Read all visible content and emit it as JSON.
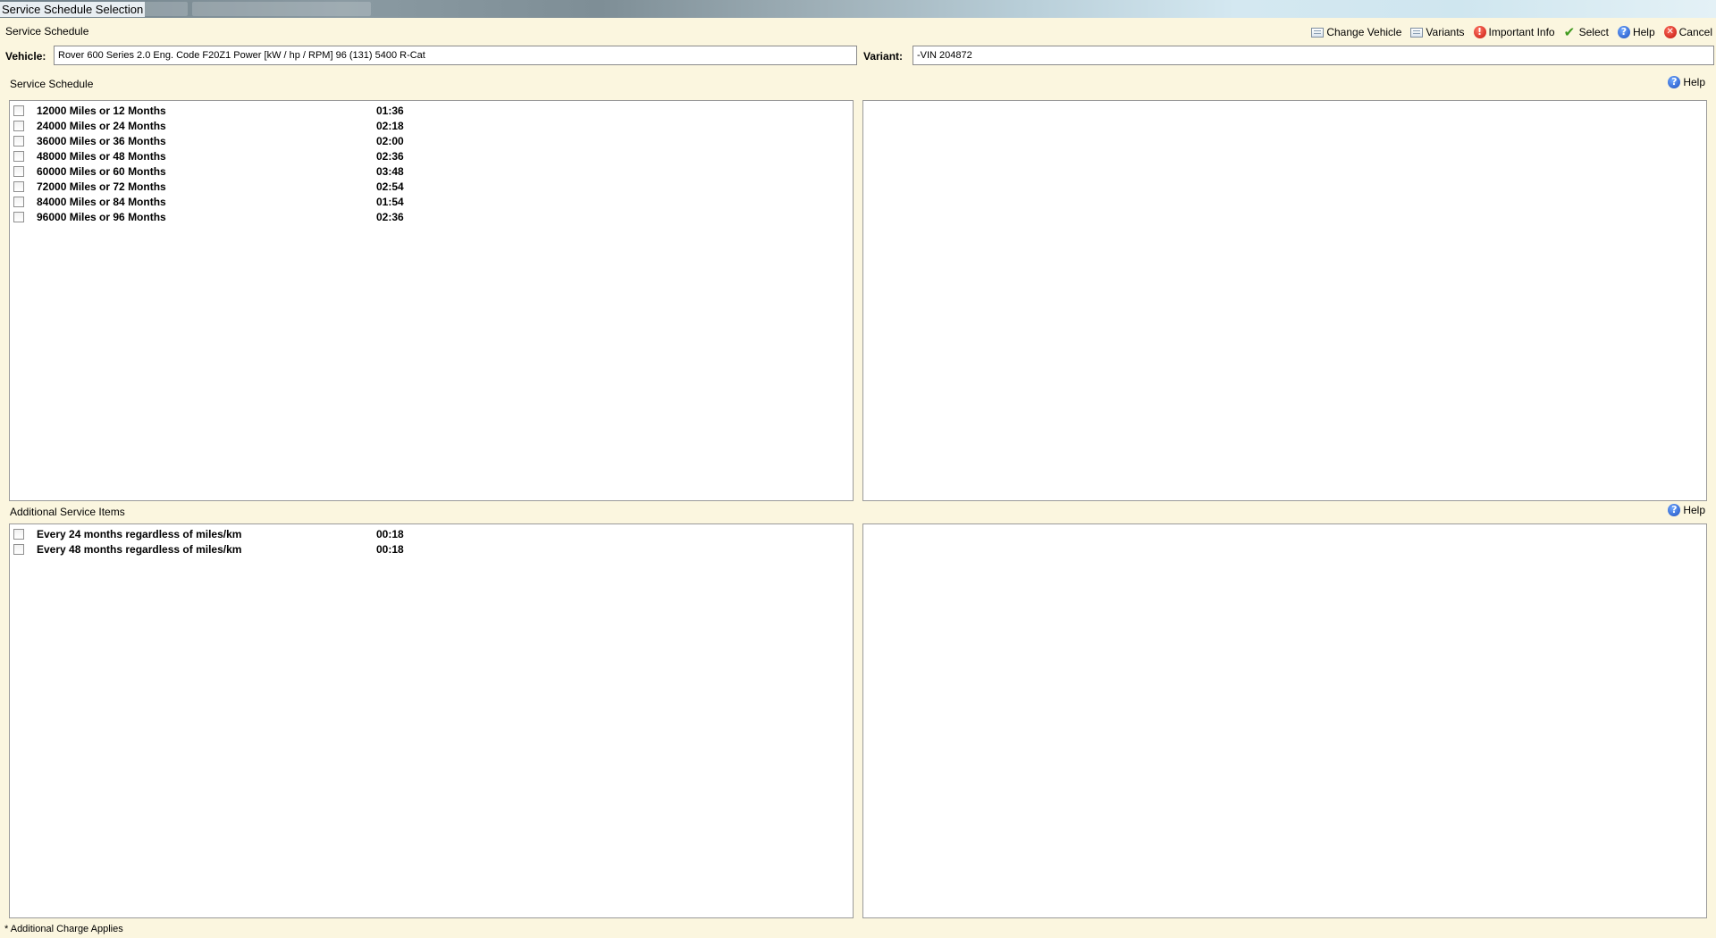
{
  "window": {
    "title": "Service Schedule Selection"
  },
  "header": {
    "section_title": "Service Schedule",
    "toolbar": [
      {
        "label": "Change Vehicle",
        "icon": "change-vehicle-icon"
      },
      {
        "label": "Variants",
        "icon": "variants-icon"
      },
      {
        "label": "Important Info",
        "icon": "important-info-icon"
      },
      {
        "label": "Select",
        "icon": "select-check-icon"
      },
      {
        "label": "Help",
        "icon": "help-icon"
      },
      {
        "label": "Cancel",
        "icon": "cancel-icon"
      }
    ]
  },
  "vehicle": {
    "vehicle_label": "Vehicle:",
    "vehicle_value": "Rover 600 Series 2.0 Eng. Code F20Z1 Power [kW / hp / RPM] 96 (131) 5400 R-Cat",
    "variant_label": "Variant:",
    "variant_value": "-VIN 204872"
  },
  "schedule_panel": {
    "title": "Service Schedule",
    "help_label": "Help",
    "items": [
      {
        "label": "12000 Miles or 12 Months",
        "time": "01:36"
      },
      {
        "label": "24000 Miles or 24 Months",
        "time": "02:18"
      },
      {
        "label": "36000 Miles or 36 Months",
        "time": "02:00"
      },
      {
        "label": "48000 Miles or 48 Months",
        "time": "02:36"
      },
      {
        "label": "60000 Miles or 60 Months",
        "time": "03:48"
      },
      {
        "label": "72000 Miles or 72 Months",
        "time": "02:54"
      },
      {
        "label": "84000 Miles or 84 Months",
        "time": "01:54"
      },
      {
        "label": "96000 Miles or 96 Months",
        "time": "02:36"
      }
    ]
  },
  "additional_panel": {
    "title": "Additional Service Items",
    "help_label": "Help",
    "items": [
      {
        "label": "Every 24 months regardless of miles/km",
        "time": "00:18"
      },
      {
        "label": "Every 48 months regardless of miles/km",
        "time": "00:18"
      }
    ]
  },
  "footer": {
    "note": "* Additional Charge Applies"
  },
  "colors": {
    "background": "#fbf6df",
    "panel_border": "#9a9a9a"
  }
}
